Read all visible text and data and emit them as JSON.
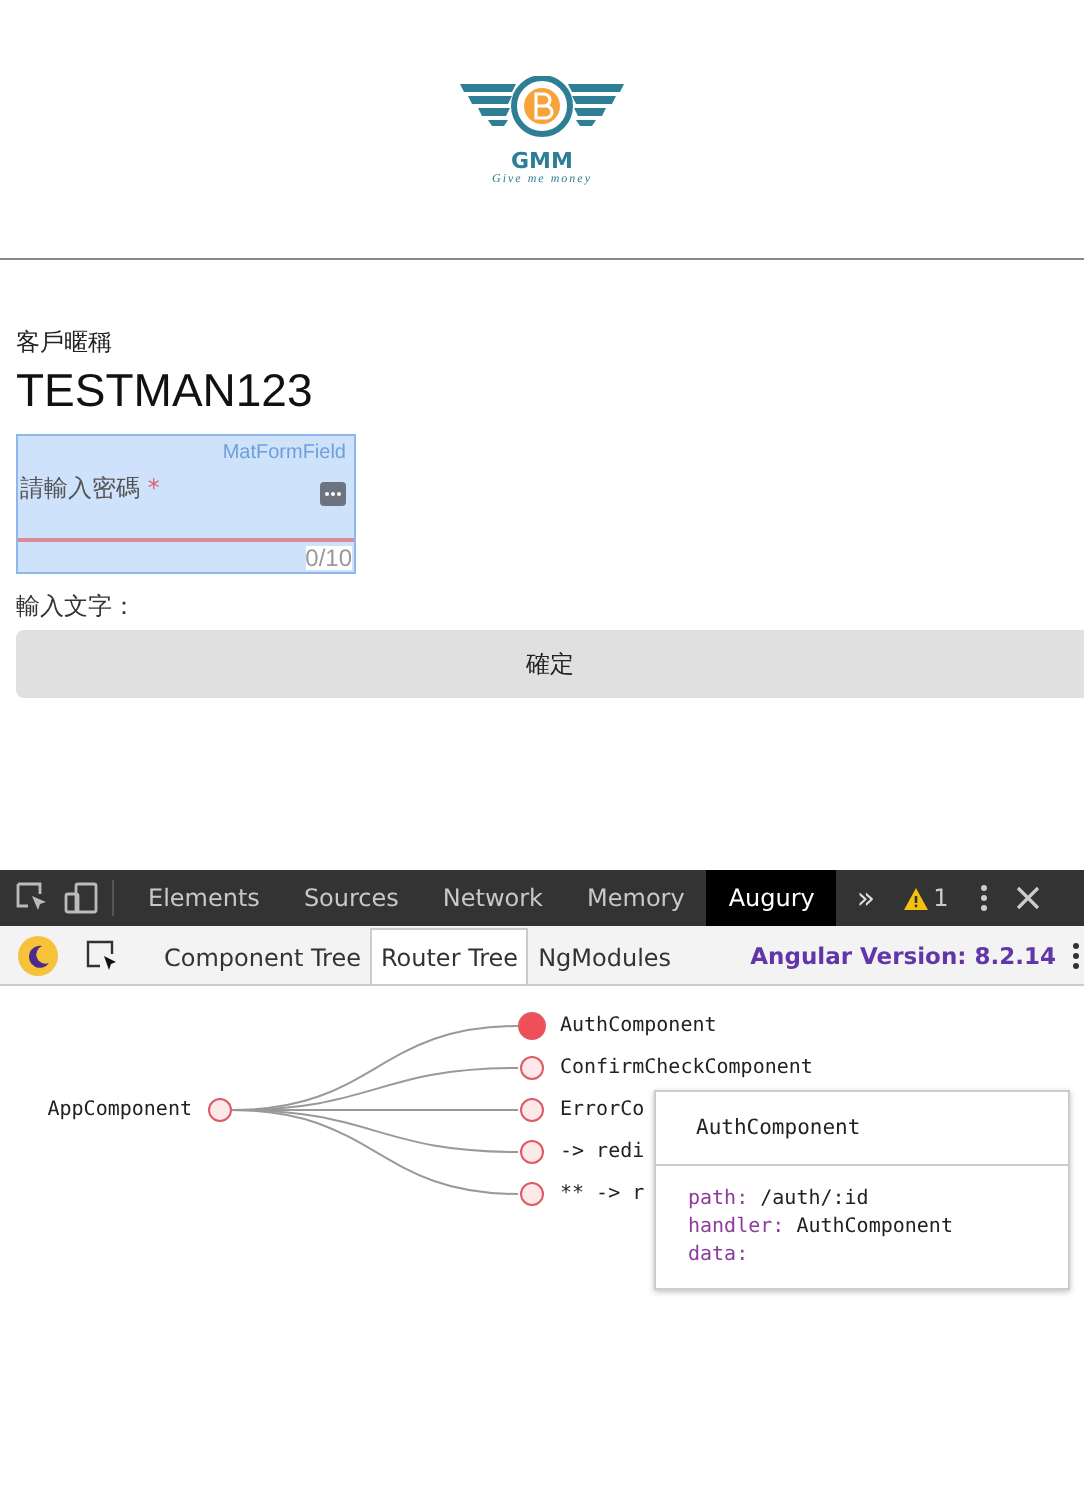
{
  "app": {
    "logo": {
      "title": "GMM",
      "tagline": "Give me money"
    },
    "nickname_label": "客戶暱稱",
    "nickname": "TESTMAN123",
    "password_field": {
      "overlay_label": "MatFormField",
      "label": "請輸入密碼",
      "required_mark": "*",
      "counter": "0/10"
    },
    "text_label": "輸入文字：",
    "confirm_button": "確定"
  },
  "devtools": {
    "tabs": [
      {
        "label": "Elements",
        "selected": false
      },
      {
        "label": "Sources",
        "selected": false
      },
      {
        "label": "Network",
        "selected": false
      },
      {
        "label": "Memory",
        "selected": false
      },
      {
        "label": "Augury",
        "selected": true
      }
    ],
    "more": "»",
    "warning_count": "1",
    "augury_tabs": [
      {
        "label": "Component Tree",
        "selected": false
      },
      {
        "label": "Router Tree",
        "selected": true
      },
      {
        "label": "NgModules",
        "selected": false
      }
    ],
    "version": "Angular Version: 8.2.14",
    "router_tree": {
      "label": "AppComponent",
      "selected": false,
      "children": [
        {
          "label": "AuthComponent",
          "selected": true
        },
        {
          "label": "ConfirmCheckComponent",
          "selected": false
        },
        {
          "label": "ErrorCo",
          "selected": false
        },
        {
          "label": "-> redi",
          "selected": false
        },
        {
          "label": "** -> r",
          "selected": false
        }
      ]
    },
    "tooltip": {
      "title": "AuthComponent",
      "properties": [
        {
          "key": "path:",
          "value": "/auth/:id"
        },
        {
          "key": "handler:",
          "value": "AuthComponent"
        },
        {
          "key": "data:"
        }
      ]
    }
  }
}
